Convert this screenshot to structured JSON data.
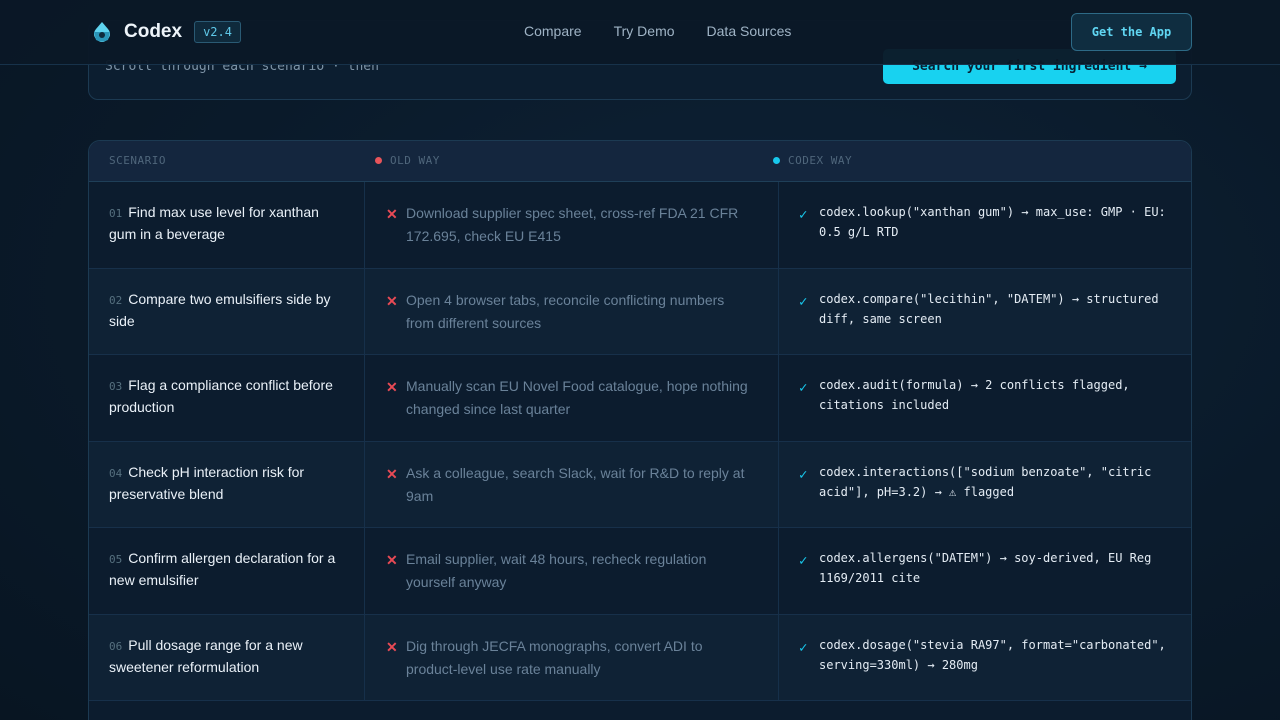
{
  "nav": {
    "brand": "Codex",
    "version": "v2.4",
    "links": [
      "Compare",
      "Try Demo",
      "Data Sources"
    ],
    "cta": "Get the App"
  },
  "hero": {
    "hint": "Scroll through each scenario · then",
    "button": "Search your first ingredient →"
  },
  "table": {
    "headers": {
      "scenario": "SCENARIO",
      "old": "OLD WAY",
      "new": "CODEX WAY"
    },
    "rows": [
      {
        "num": "01",
        "scenario": "Find max use level for xanthan gum in a beverage",
        "old": "Download supplier spec sheet, cross-ref FDA 21 CFR 172.695, check EU E415",
        "new": "codex.lookup(\"xanthan gum\") → max_use: GMP · EU: 0.5 g/L RTD"
      },
      {
        "num": "02",
        "scenario": "Compare two emulsifiers side by side",
        "old": "Open 4 browser tabs, reconcile conflicting numbers from different sources",
        "new": "codex.compare(\"lecithin\", \"DATEM\") → structured diff, same screen"
      },
      {
        "num": "03",
        "scenario": "Flag a compliance conflict before production",
        "old": "Manually scan EU Novel Food catalogue, hope nothing changed since last quarter",
        "new": "codex.audit(formula) → 2 conflicts flagged, citations included"
      },
      {
        "num": "04",
        "scenario": "Check pH interaction risk for preservative blend",
        "old": "Ask a colleague, search Slack, wait for R&D to reply at 9am",
        "new": "codex.interactions([\"sodium benzoate\", \"citric acid\"], pH=3.2) → ⚠ flagged"
      },
      {
        "num": "05",
        "scenario": "Confirm allergen declaration for a new emulsifier",
        "old": "Email supplier, wait 48 hours, recheck regulation yourself anyway",
        "new": "codex.allergens(\"DATEM\") → soy-derived, EU Reg 1169/2011 cite"
      },
      {
        "num": "06",
        "scenario": "Pull dosage range for a new sweetener reformulation",
        "old": "Dig through JECFA monographs, convert ADI to product-level use rate manually",
        "new": "codex.dosage(\"stevia RA97\", format=\"carbonated\", serving=330ml) → 280mg"
      }
    ]
  },
  "icons": {
    "logo": "droplet-logo-icon",
    "old": "x-icon",
    "new": "check-icon"
  },
  "colors": {
    "accent": "#18d2f0",
    "danger": "#e84a55",
    "background": "#0a1a2a"
  }
}
